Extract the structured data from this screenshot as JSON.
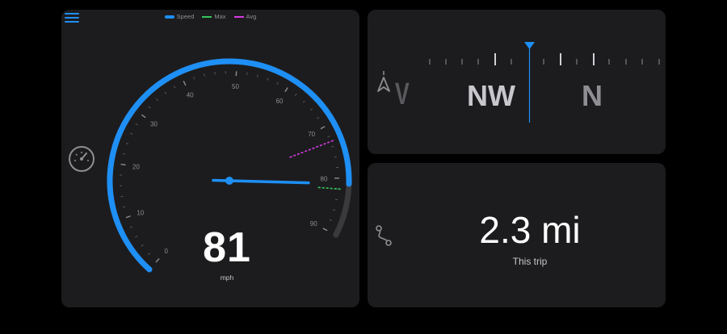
{
  "speedometer": {
    "legend": [
      {
        "label": "Speed",
        "style": "solid",
        "color": "#1e8ff5"
      },
      {
        "label": "Max",
        "style": "dashed",
        "color": "#34c759"
      },
      {
        "label": "Avg",
        "style": "dashed",
        "color": "#d83ae6"
      }
    ],
    "scale_labels": [
      "0",
      "10",
      "20",
      "30",
      "40",
      "50",
      "60",
      "70",
      "80",
      "90"
    ],
    "scale_min": 0,
    "scale_max": 90,
    "speed": 81,
    "speed_display": "81",
    "max_speed": 82,
    "avg_speed": 73,
    "unit": "mph",
    "colors": {
      "speed": "#1e8ff5",
      "max": "#34c759",
      "avg": "#d83ae6",
      "track": "#3a3a3c"
    }
  },
  "compass": {
    "visible_labels": [
      "V",
      "NW",
      "N"
    ],
    "heading_marker_color": "#1e8ff5"
  },
  "trip": {
    "value": "2.3 mi",
    "caption": "This trip"
  },
  "icons": {
    "menu": "menu-icon",
    "speedometer": "speedometer-icon",
    "navigation": "navigation-arrow-icon",
    "route": "route-icon"
  }
}
